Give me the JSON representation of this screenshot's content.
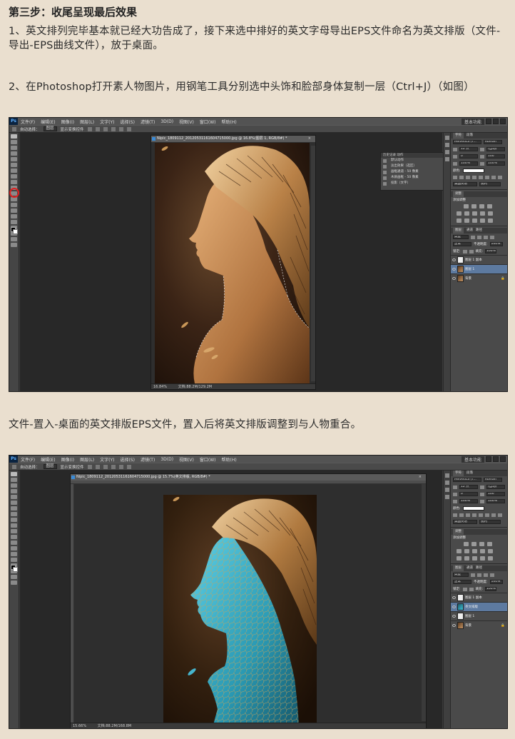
{
  "heading": "第三步：收尾呈现最后效果",
  "para1": "1、英文排列完毕基本就已经大功告成了，接下来选中排好的英文字母导出EPS文件命名为英文排版（文件-导出-EPS曲线文件），放于桌面。",
  "para2": "2、在Photoshop打开素人物图片，用钢笔工具分别选中头饰和脸部身体复制一层（Ctrl+J）（如图）",
  "para3": "文件-置入-桌面的英文排版EPS文件，置入后将英文排版调整到与人物重合。",
  "screenshot1": {
    "logo": "Ps",
    "menu": [
      "文件(F)",
      "编辑(E)",
      "图像(I)",
      "图层(L)",
      "文字(Y)",
      "选择(S)",
      "滤镜(T)",
      "3D(D)",
      "视图(V)",
      "窗口(W)",
      "帮助(H)"
    ],
    "workspace": "基本功能",
    "options": {
      "auto_select": "自动选择：",
      "auto_select_value": "图层",
      "show_transform": "显示变换控件"
    },
    "doc_tab": "Nipic_1809112_20120531161604715000.jpg @ 16.8%(图层 1, RGB/8#) *",
    "zoom": "16.84%",
    "doc_size": "文档:88.2M/129.2M",
    "history_panel": {
      "tabs": "历史记录  动作",
      "rows": [
        "默认动作",
        "淡出效果（选区）",
        "画框通道 - 50 像素",
        "木质画框 - 50 像素",
        "投影（文字）"
      ]
    },
    "right": {
      "tabs": [
        "字符",
        "段落"
      ],
      "font": "Helvetica (T...",
      "style": "Roman",
      "size": "12 点",
      "leading": "(自动)",
      "kern": "0",
      "track": "100",
      "scale_v": "100%",
      "scale_h": "100%",
      "color_label": "颜色:",
      "language": "美国英语",
      "aa": "锐利",
      "adjust_title": "调整",
      "adjust_sub": "添加调整",
      "layers_tabs": [
        "图层",
        "通道",
        "路径"
      ],
      "kind": "类型",
      "blend": "正常",
      "opacity_label": "不透明度:",
      "opacity": "100%",
      "lock": "锁定:",
      "fill_label": "填充:",
      "fill": "100%",
      "layers": [
        "图层 1 副本",
        "图层 1",
        "背景"
      ]
    }
  },
  "screenshot2": {
    "logo": "Ps",
    "menu": [
      "文件(F)",
      "编辑(E)",
      "图像(I)",
      "图层(L)",
      "文字(Y)",
      "选择(S)",
      "滤镜(T)",
      "3D(D)",
      "视图(V)",
      "窗口(W)",
      "帮助(H)"
    ],
    "workspace": "基本功能",
    "options": {
      "auto_select": "自动选择：",
      "auto_select_value": "图层",
      "show_transform": "显示变换控件"
    },
    "doc_tab": "Nipic_1809112_20120531161604715000.jpg @ 15.7%(英文排版, RGB/8#) *",
    "zoom": "15.66%",
    "doc_size": "文档:88.2M/168.8M",
    "right": {
      "tabs": [
        "字符",
        "段落"
      ],
      "font": "Helvetica (T...",
      "style": "Roman",
      "size": "12 点",
      "leading": "(自动)",
      "kern": "0",
      "track": "100",
      "scale_v": "100%",
      "scale_h": "100%",
      "color_label": "颜色:",
      "language": "美国英语",
      "aa": "锐利",
      "adjust_title": "调整",
      "adjust_sub": "添加调整",
      "layers_tabs": [
        "图层",
        "通道",
        "路径"
      ],
      "kind": "类型",
      "blend": "正常",
      "opacity_label": "不透明度:",
      "opacity": "100%",
      "lock": "锁定:",
      "fill_label": "填充:",
      "fill": "100%",
      "layers": [
        "图层 1 副本",
        "英文排版",
        "图层 1",
        "背景"
      ]
    }
  }
}
